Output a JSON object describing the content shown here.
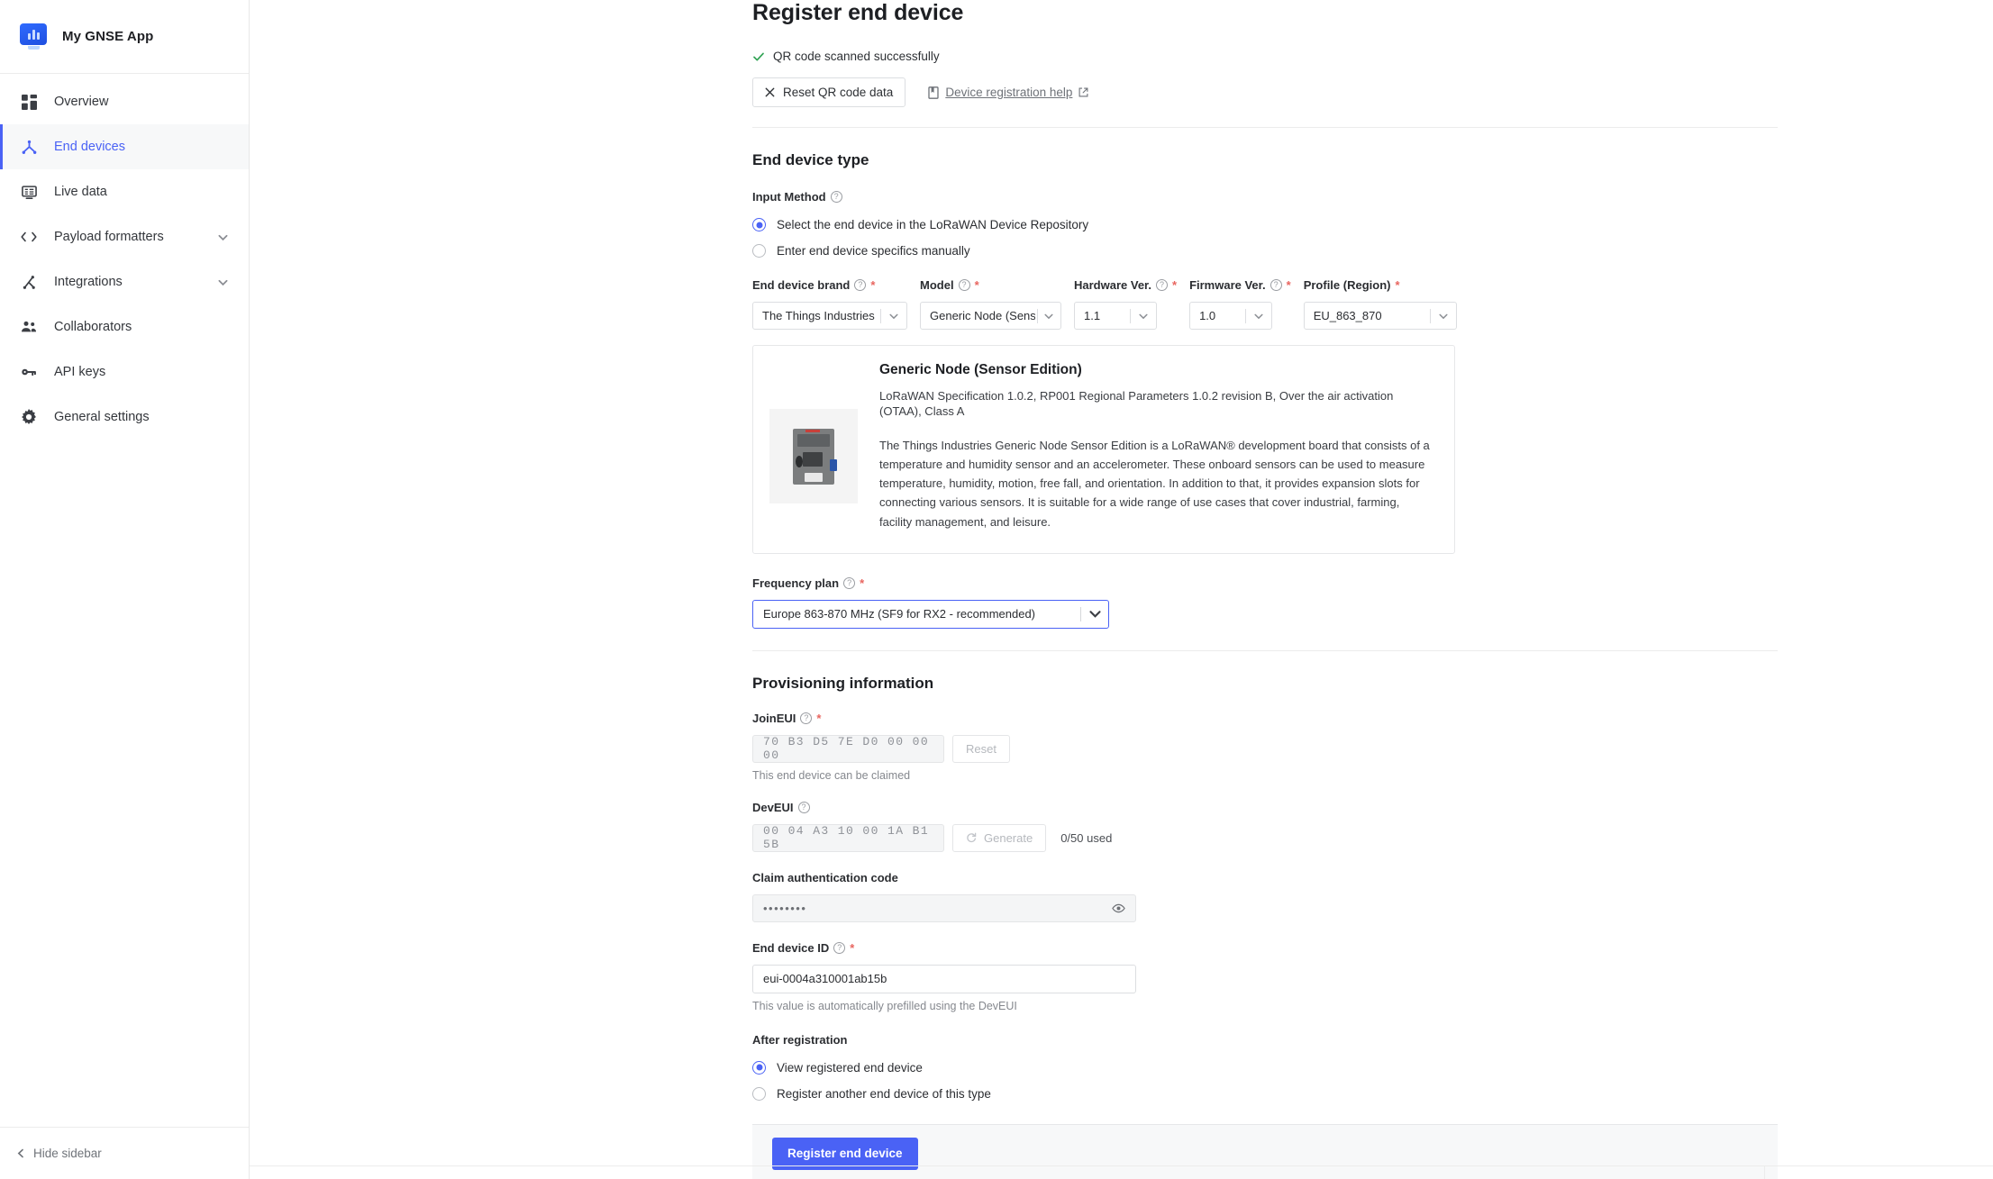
{
  "sidebar": {
    "app_title": "My GNSE App",
    "logo_icon": "monitor-bar-chart-icon",
    "items": [
      {
        "label": "Overview",
        "icon": "grid-icon",
        "active": false,
        "expandable": false
      },
      {
        "label": "End devices",
        "icon": "device-node-icon",
        "active": true,
        "expandable": false
      },
      {
        "label": "Live data",
        "icon": "monitor-list-icon",
        "active": false,
        "expandable": false
      },
      {
        "label": "Payload formatters",
        "icon": "code-brackets-icon",
        "active": false,
        "expandable": true
      },
      {
        "label": "Integrations",
        "icon": "integration-node-icon",
        "active": false,
        "expandable": true
      },
      {
        "label": "Collaborators",
        "icon": "people-icon",
        "active": false,
        "expandable": false
      },
      {
        "label": "API keys",
        "icon": "key-icon",
        "active": false,
        "expandable": false
      },
      {
        "label": "General settings",
        "icon": "gear-icon",
        "active": false,
        "expandable": false
      }
    ],
    "hide_sidebar_label": "Hide sidebar",
    "hide_sidebar_icon": "chevron-left-icon"
  },
  "page": {
    "title": "Register end device",
    "qr_status": "QR code scanned successfully",
    "qr_status_icon": "check-icon",
    "reset_qr_button": "Reset QR code data",
    "reset_qr_icon": "close-x-icon",
    "help_link": "Device registration help",
    "help_link_icon": "book-icon",
    "help_external_icon": "external-link-icon"
  },
  "end_device_type": {
    "heading": "End device type",
    "input_method_label": "Input Method",
    "options": [
      {
        "label": "Select the end device in the LoRaWAN Device Repository",
        "selected": true
      },
      {
        "label": "Enter end device specifics manually",
        "selected": false
      }
    ],
    "selects": [
      {
        "label": "End device brand",
        "value": "The Things Industries",
        "required": true,
        "has_help": true
      },
      {
        "label": "Model",
        "value": "Generic Node (Sens...",
        "required": true,
        "has_help": true
      },
      {
        "label": "Hardware Ver.",
        "value": "1.1",
        "required": true,
        "has_help": true
      },
      {
        "label": "Firmware Ver.",
        "value": "1.0",
        "required": true,
        "has_help": true
      },
      {
        "label": "Profile (Region)",
        "value": "EU_863_870",
        "required": true,
        "has_help": false
      }
    ]
  },
  "device_card": {
    "name": "Generic Node (Sensor Edition)",
    "spec": "LoRaWAN Specification 1.0.2, RP001 Regional Parameters 1.0.2 revision B, Over the air activation (OTAA), Class A",
    "description": "The Things Industries Generic Node Sensor Edition is a LoRaWAN® development board that consists of a temperature and humidity sensor and an accelerometer. These onboard sensors can be used to measure temperature, humidity, motion, free fall, and orientation. In addition to that, it provides expansion slots for connecting various sensors. It is suitable for a wide range of use cases that cover industrial, farming, facility management, and leisure.",
    "image_alt": "generic-node-board-image"
  },
  "frequency_plan": {
    "label": "Frequency plan",
    "required": true,
    "value": "Europe 863-870 MHz (SF9 for RX2 - recommended)",
    "chevron_icon": "chevron-down-icon"
  },
  "provisioning": {
    "heading": "Provisioning information",
    "join_eui": {
      "label": "JoinEUI",
      "required": true,
      "value": "70 B3 D5 7E D0 00 00 00",
      "reset_button": "Reset",
      "hint": "This end device can be claimed"
    },
    "dev_eui": {
      "label": "DevEUI",
      "required": false,
      "value": "00 04 A3 10 00 1A B1 5B",
      "generate_button": "Generate",
      "generate_icon": "refresh-icon",
      "usage": "0/50 used"
    },
    "claim_code": {
      "label": "Claim authentication code",
      "value": "••••••••",
      "reveal_icon": "eye-icon"
    },
    "end_device_id": {
      "label": "End device ID",
      "required": true,
      "value": "eui-0004a310001ab15b",
      "hint": "This value is automatically prefilled using the DevEUI"
    }
  },
  "after_registration": {
    "heading": "After registration",
    "options": [
      {
        "label": "View registered end device",
        "selected": true
      },
      {
        "label": "Register another end device of this type",
        "selected": false
      }
    ]
  },
  "submit": {
    "label": "Register end device"
  },
  "colors": {
    "accent": "#4a62f5",
    "success": "#31a354",
    "required": "#e8655f",
    "sidebar_active_bg": "#f7f8f9",
    "footer_bg": "#f7f8f9"
  }
}
